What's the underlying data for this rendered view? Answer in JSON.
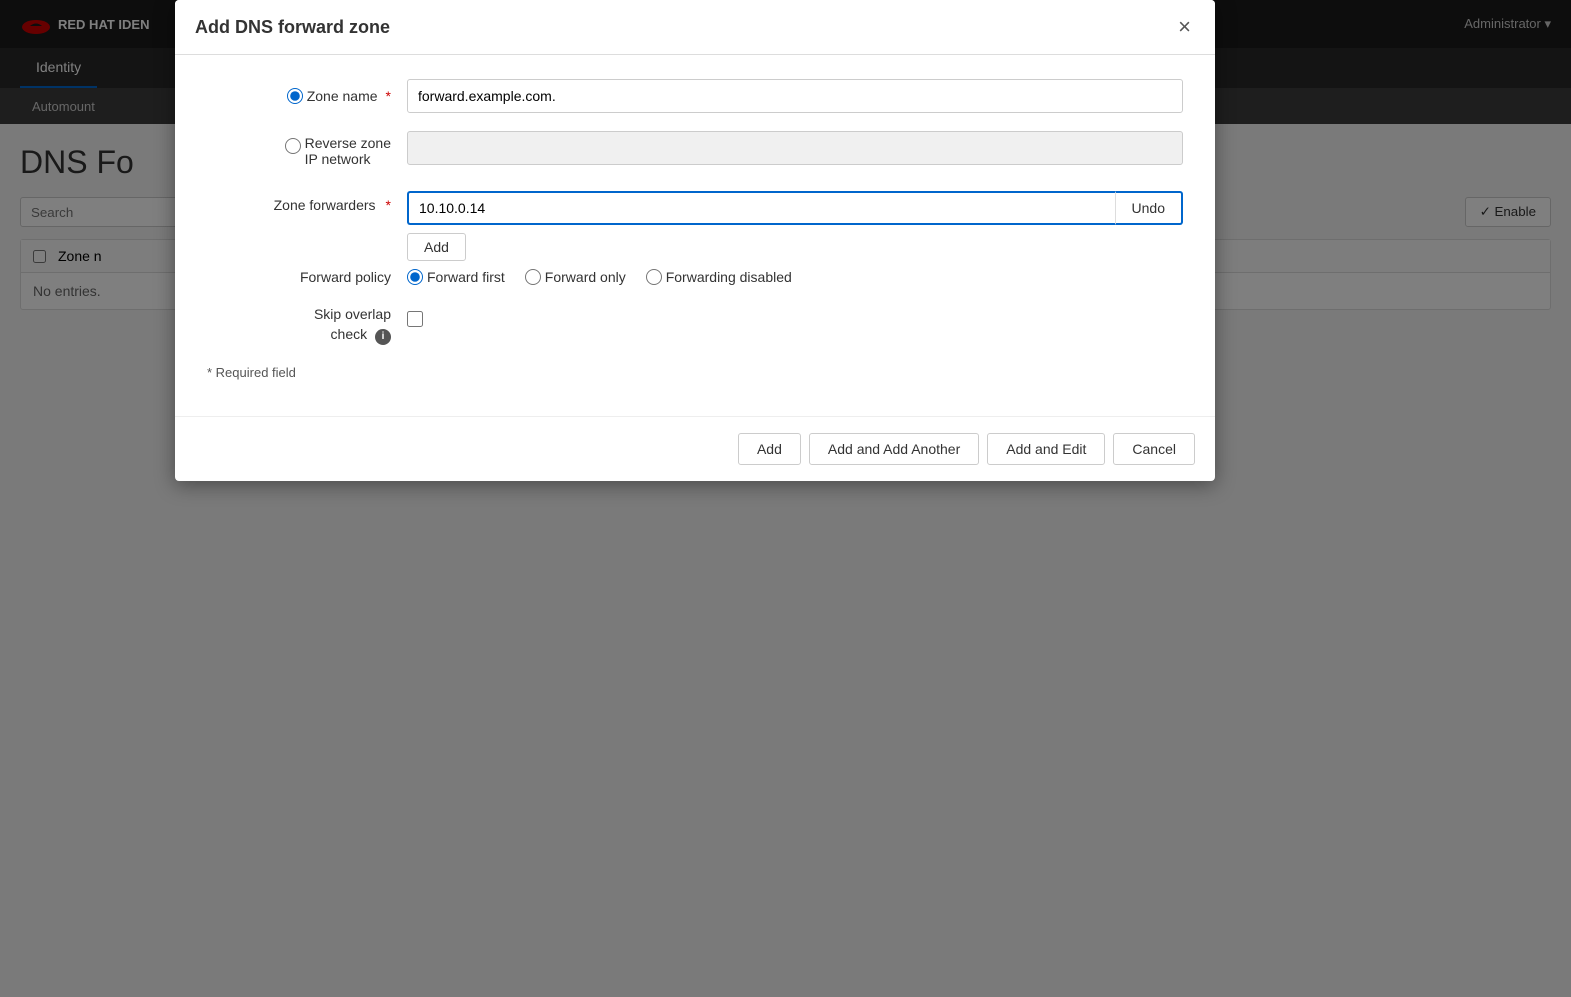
{
  "topbar": {
    "brand": "RED HAT IDEN",
    "admin": "Administrator"
  },
  "nav": {
    "active_item": "Identity"
  },
  "subnav": {
    "active_item": "Automount"
  },
  "page": {
    "title": "DNS Fo",
    "search_placeholder": "Search",
    "enable_button": "✓ Enable",
    "no_entries": "No entries.",
    "zone_name_col": "Zone n"
  },
  "modal": {
    "title": "Add DNS forward zone",
    "close_label": "×",
    "zone_name_label": "Zone name",
    "zone_name_required": "*",
    "zone_name_value": "forward.example.com.",
    "reverse_zone_label": "Reverse zone\nIP network",
    "reverse_zone_line1": "Reverse zone",
    "reverse_zone_line2": "IP network",
    "zone_forwarders_label": "Zone forwarders",
    "zone_forwarders_required": "*",
    "zone_forwarders_value": "10.10.0.14",
    "undo_button": "Undo",
    "add_forwarder_button": "Add",
    "forward_policy_label": "Forward policy",
    "policy_options": [
      {
        "id": "forward_first",
        "label": "Forward first",
        "checked": true
      },
      {
        "id": "forward_only",
        "label": "Forward only",
        "checked": false
      },
      {
        "id": "forwarding_disabled",
        "label": "Forwarding disabled",
        "checked": false
      }
    ],
    "skip_overlap_label_line1": "Skip overlap",
    "skip_overlap_label_line2": "check",
    "skip_overlap_checked": false,
    "required_field_note": "* Required field",
    "footer_buttons": {
      "add": "Add",
      "add_and_add_another": "Add and Add Another",
      "add_and_edit": "Add and Edit",
      "cancel": "Cancel"
    }
  }
}
